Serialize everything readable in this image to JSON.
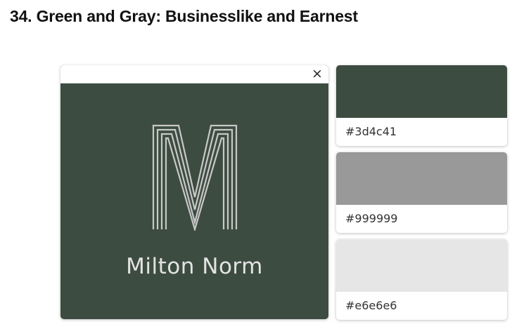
{
  "page": {
    "title": "34. Green and Gray: Businesslike and Earnest"
  },
  "preview": {
    "close_label": "×",
    "logo_text": "Milton Norm",
    "logo_icon": "letter-m-lines-logo",
    "background": "#3d4c41",
    "logo_color": "#c8c8c8"
  },
  "swatches": [
    {
      "hex": "#3d4c41",
      "label": "#3d4c41"
    },
    {
      "hex": "#999999",
      "label": "#999999"
    },
    {
      "hex": "#e6e6e6",
      "label": "#e6e6e6"
    }
  ]
}
